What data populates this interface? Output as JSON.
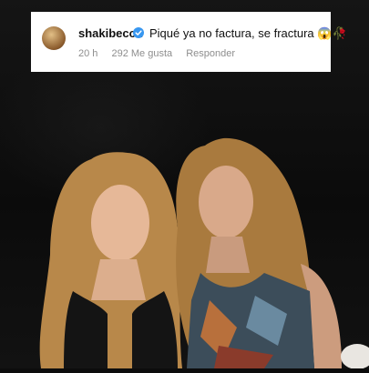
{
  "comment": {
    "username": "shakibecca",
    "text": "Piqué ya no factura, se fractura 😱🥀",
    "time": "20 h",
    "likes": "292 Me gusta",
    "reply_label": "Responder"
  },
  "icons": {
    "avatar": "avatar",
    "verified": "verified-badge-icon"
  },
  "colors": {
    "verified": "#3897f0",
    "meta_text": "#8e8e8e"
  }
}
